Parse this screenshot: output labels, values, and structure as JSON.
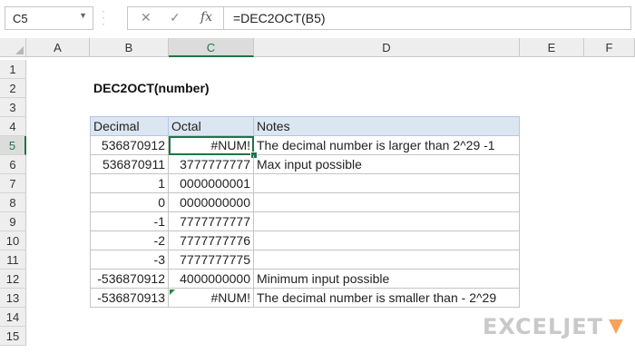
{
  "formula_bar": {
    "name_box": "C5",
    "formula": "=DEC2OCT(B5)",
    "cancel_icon": "close-icon",
    "confirm_icon": "check-icon",
    "fx_label": "fx"
  },
  "columns": [
    "A",
    "B",
    "C",
    "D",
    "E",
    "F"
  ],
  "rows": [
    "1",
    "2",
    "3",
    "4",
    "5",
    "6",
    "7",
    "8",
    "9",
    "10",
    "11",
    "12",
    "13",
    "14",
    "15"
  ],
  "active_cell": {
    "column": "C",
    "row": "5"
  },
  "sheet": {
    "title": "DEC2OCT(number)",
    "headers": {
      "decimal": "Decimal",
      "octal": "Octal",
      "notes": "Notes"
    },
    "table": [
      {
        "decimal": "536870912",
        "octal": "#NUM!",
        "notes": "The decimal number is larger than 2^29 -1"
      },
      {
        "decimal": "536870911",
        "octal": "3777777777",
        "notes": "Max input possible"
      },
      {
        "decimal": "1",
        "octal": "0000000001",
        "notes": ""
      },
      {
        "decimal": "0",
        "octal": "0000000000",
        "notes": ""
      },
      {
        "decimal": "-1",
        "octal": "7777777777",
        "notes": ""
      },
      {
        "decimal": "-2",
        "octal": "7777777776",
        "notes": ""
      },
      {
        "decimal": "-3",
        "octal": "7777777775",
        "notes": ""
      },
      {
        "decimal": "-536870912",
        "octal": "4000000000",
        "notes": "Minimum input possible"
      },
      {
        "decimal": "-536870913",
        "octal": "#NUM!",
        "notes": "The decimal number is smaller than - 2^29"
      }
    ]
  },
  "logo": {
    "text": "EXCELJET",
    "icon": "exceljet-logo-icon"
  },
  "colors": {
    "accent": "#217346",
    "header_fill": "#dce6f1",
    "logo": "#c9c9c9",
    "logo_mark": "#f5a25d"
  }
}
